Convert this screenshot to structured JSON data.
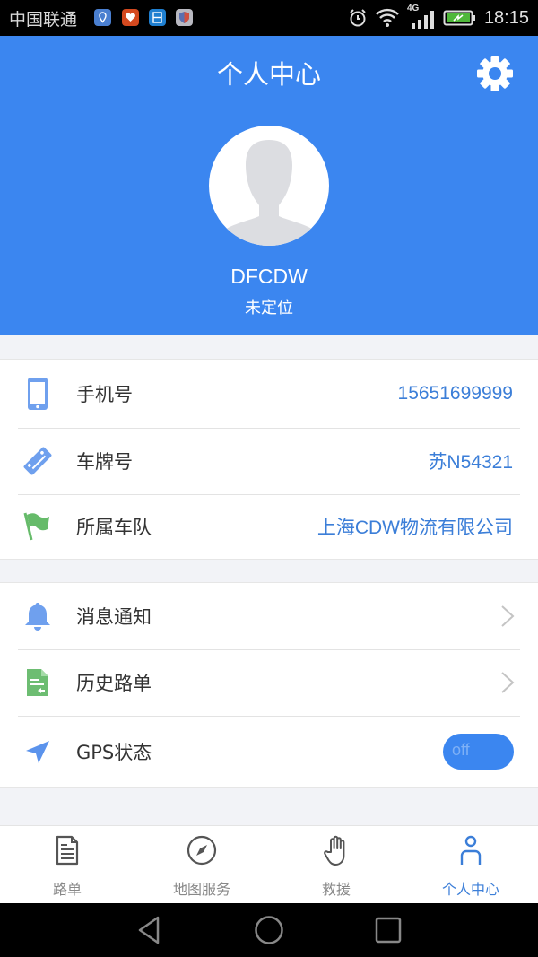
{
  "status_bar": {
    "carrier": "中国联通",
    "network": "4G",
    "time": "18:15",
    "notification_icons": [
      "location-app-icon",
      "heart-app-icon",
      "calendar-app-icon",
      "shield-app-icon"
    ]
  },
  "header": {
    "title": "个人中心",
    "settings_icon": "gear-icon",
    "accent_color": "#3b86f0"
  },
  "profile": {
    "username": "DFCDW",
    "location_status": "未定位"
  },
  "info_group": [
    {
      "icon": "phone-icon",
      "label": "手机号",
      "value": "15651699999"
    },
    {
      "icon": "ticket-icon",
      "label": "车牌号",
      "value": "苏N54321"
    },
    {
      "icon": "flag-icon",
      "label": "所属车队",
      "value": "上海CDW物流有限公司"
    }
  ],
  "action_group": [
    {
      "icon": "bell-icon",
      "label": "消息通知",
      "control": "chevron"
    },
    {
      "icon": "document-icon",
      "label": "历史路单",
      "control": "chevron"
    },
    {
      "icon": "navigation-arrow-icon",
      "label": "GPS状态",
      "control": "toggle",
      "toggle_text": "off"
    }
  ],
  "tabbar": {
    "tabs": [
      {
        "label": "路单",
        "icon": "document-icon",
        "active": false
      },
      {
        "label": "地图服务",
        "icon": "compass-icon",
        "active": false
      },
      {
        "label": "救援",
        "icon": "hand-icon",
        "active": false
      },
      {
        "label": "个人中心",
        "icon": "person-icon",
        "active": true
      }
    ],
    "active_color": "#3b7ed8",
    "inactive_color": "#888888"
  },
  "nav_bar": {
    "buttons": [
      "back-icon",
      "home-icon",
      "recents-icon"
    ]
  }
}
